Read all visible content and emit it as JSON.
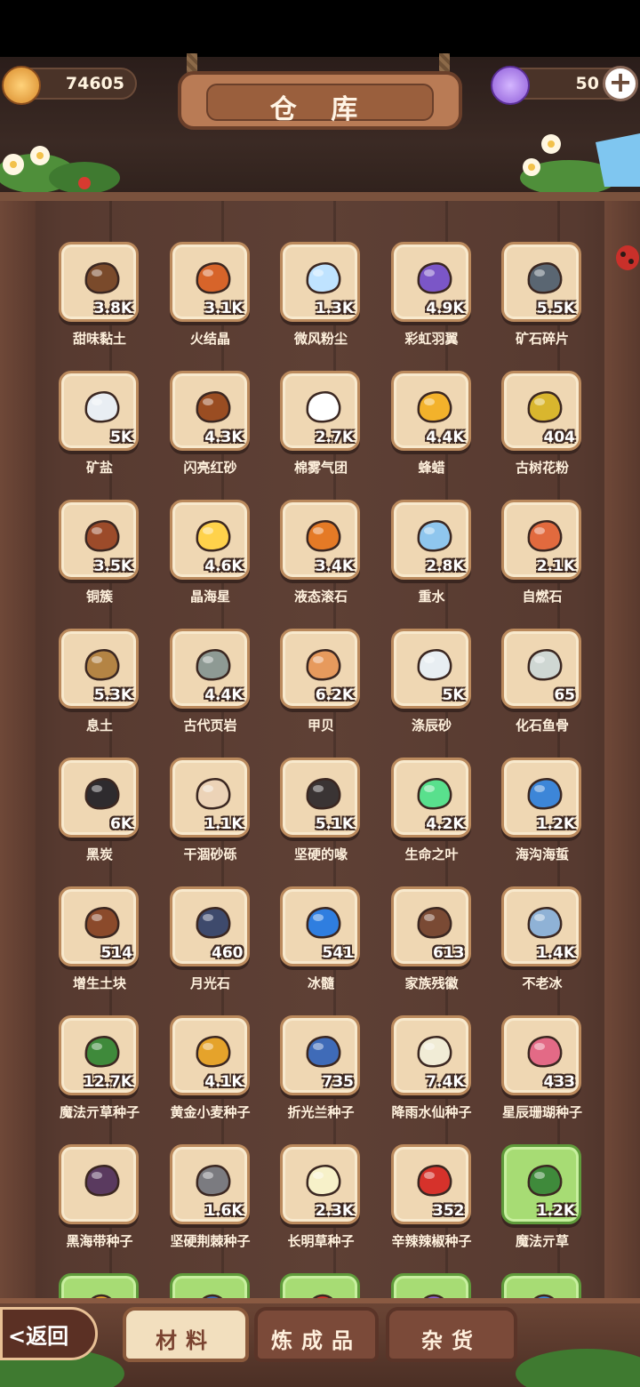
{
  "header": {
    "title": "仓 库",
    "gold_amount": "74605",
    "gem_amount": "50"
  },
  "items": [
    {
      "name": "甜味黏土",
      "count": "3.8K",
      "icon": "clay-icon",
      "color": "#7a4a2b",
      "highlight": false
    },
    {
      "name": "火结晶",
      "count": "3.1K",
      "icon": "fire-crystal-icon",
      "color": "#d7642a",
      "highlight": false
    },
    {
      "name": "微风粉尘",
      "count": "1.3K",
      "icon": "breeze-dust-icon",
      "color": "#bfe3ff",
      "highlight": false
    },
    {
      "name": "彩虹羽翼",
      "count": "4.9K",
      "icon": "rainbow-wing-icon",
      "color": "#7b56c7",
      "highlight": false
    },
    {
      "name": "矿石碎片",
      "count": "5.5K",
      "icon": "ore-shard-icon",
      "color": "#5a6672",
      "highlight": false
    },
    {
      "name": "矿盐",
      "count": "5K",
      "icon": "rock-salt-icon",
      "color": "#e9eef3",
      "highlight": false
    },
    {
      "name": "闪亮红砂",
      "count": "4.3K",
      "icon": "red-sand-icon",
      "color": "#9a4d22",
      "highlight": false
    },
    {
      "name": "棉雾气团",
      "count": "2.7K",
      "icon": "cotton-mist-icon",
      "color": "#ffffff",
      "highlight": false
    },
    {
      "name": "蜂蜡",
      "count": "4.4K",
      "icon": "beeswax-icon",
      "color": "#f3b22b",
      "highlight": false
    },
    {
      "name": "古树花粉",
      "count": "404",
      "icon": "pollen-icon",
      "color": "#d9b62e",
      "highlight": false
    },
    {
      "name": "铜簇",
      "count": "3.5K",
      "icon": "copper-cluster-icon",
      "color": "#9c4b2a",
      "highlight": false
    },
    {
      "name": "晶海星",
      "count": "4.6K",
      "icon": "starfish-icon",
      "color": "#ffd24b",
      "highlight": false
    },
    {
      "name": "液态滚石",
      "count": "3.4K",
      "icon": "molten-rock-icon",
      "color": "#e57a26",
      "highlight": false
    },
    {
      "name": "重水",
      "count": "2.8K",
      "icon": "heavy-water-icon",
      "color": "#8fc6ee",
      "highlight": false
    },
    {
      "name": "自燃石",
      "count": "2.1K",
      "icon": "burning-stone-icon",
      "color": "#e26a3e",
      "highlight": false
    },
    {
      "name": "息土",
      "count": "5.3K",
      "icon": "soil-icon",
      "color": "#b48444",
      "highlight": false
    },
    {
      "name": "古代页岩",
      "count": "4.4K",
      "icon": "shale-icon",
      "color": "#8e9a94",
      "highlight": false
    },
    {
      "name": "甲贝",
      "count": "6.2K",
      "icon": "shell-icon",
      "color": "#e79a5d",
      "highlight": false
    },
    {
      "name": "涤辰砂",
      "count": "5K",
      "icon": "star-sand-icon",
      "color": "#e8eef2",
      "highlight": false
    },
    {
      "name": "化石鱼骨",
      "count": "65",
      "icon": "fishbone-icon",
      "color": "#cfd7d3",
      "highlight": false
    },
    {
      "name": "黑炭",
      "count": "6K",
      "icon": "charcoal-icon",
      "color": "#2e2b2e",
      "highlight": false
    },
    {
      "name": "干涸砂砾",
      "count": "1.1K",
      "icon": "dry-gravel-icon",
      "color": "#ecd3b7",
      "highlight": false
    },
    {
      "name": "坚硬的喙",
      "count": "5.1K",
      "icon": "beak-icon",
      "color": "#3a3434",
      "highlight": false
    },
    {
      "name": "生命之叶",
      "count": "4.2K",
      "icon": "life-leaf-icon",
      "color": "#59e08d",
      "highlight": false
    },
    {
      "name": "海沟海蜇",
      "count": "1.2K",
      "icon": "jellyfish-icon",
      "color": "#3d86d8",
      "highlight": false
    },
    {
      "name": "增生土块",
      "count": "514",
      "icon": "dirt-clod-icon",
      "color": "#8b4a2b",
      "highlight": false
    },
    {
      "name": "月光石",
      "count": "460",
      "icon": "moonstone-icon",
      "color": "#3e4a6c",
      "highlight": false
    },
    {
      "name": "冰髓",
      "count": "541",
      "icon": "ice-marrow-icon",
      "color": "#2f7ee0",
      "highlight": false
    },
    {
      "name": "家族残徽",
      "count": "613",
      "icon": "broken-crest-icon",
      "color": "#7a4a34",
      "highlight": false
    },
    {
      "name": "不老冰",
      "count": "1.4K",
      "icon": "eternal-ice-icon",
      "color": "#8fb2d6",
      "highlight": false
    },
    {
      "name": "魔法亓草种子",
      "count": "12.7K",
      "icon": "herb-seed-icon",
      "color": "#3f8a3b",
      "highlight": false
    },
    {
      "name": "黄金小麦种子",
      "count": "4.1K",
      "icon": "wheat-seed-icon",
      "color": "#e5a32b",
      "highlight": false
    },
    {
      "name": "折光兰种子",
      "count": "735",
      "icon": "orchid-seed-icon",
      "color": "#3f6bb8",
      "highlight": false
    },
    {
      "name": "降雨水仙种子",
      "count": "7.4K",
      "icon": "narcissus-seed-icon",
      "color": "#f1ecd6",
      "highlight": false
    },
    {
      "name": "星辰珊瑚种子",
      "count": "433",
      "icon": "coral-seed-icon",
      "color": "#e36a86",
      "highlight": false
    },
    {
      "name": "黑海带种子",
      "count": "",
      "icon": "kelp-seed-icon",
      "color": "#5a3a5f",
      "highlight": false
    },
    {
      "name": "坚硬荆棘种子",
      "count": "1.6K",
      "icon": "thorn-seed-icon",
      "color": "#7b7b80",
      "highlight": false
    },
    {
      "name": "长明草种子",
      "count": "2.3K",
      "icon": "everbright-seed-icon",
      "color": "#f7f1c9",
      "highlight": false
    },
    {
      "name": "辛辣辣椒种子",
      "count": "352",
      "icon": "chili-seed-icon",
      "color": "#d6322b",
      "highlight": false
    },
    {
      "name": "魔法亓草",
      "count": "1.2K",
      "icon": "herb-icon",
      "color": "#3f8a3b",
      "highlight": true
    }
  ],
  "partial_row_colors": [
    "#e5a32b",
    "#3f6bb8",
    "#d6322b",
    "#8a5fd1",
    "#3d86d8"
  ],
  "bottom": {
    "back_label": "<返回",
    "tabs": [
      {
        "label": "材料",
        "active": true
      },
      {
        "label": "炼成品",
        "active": false
      },
      {
        "label": "杂货",
        "active": false
      }
    ]
  }
}
